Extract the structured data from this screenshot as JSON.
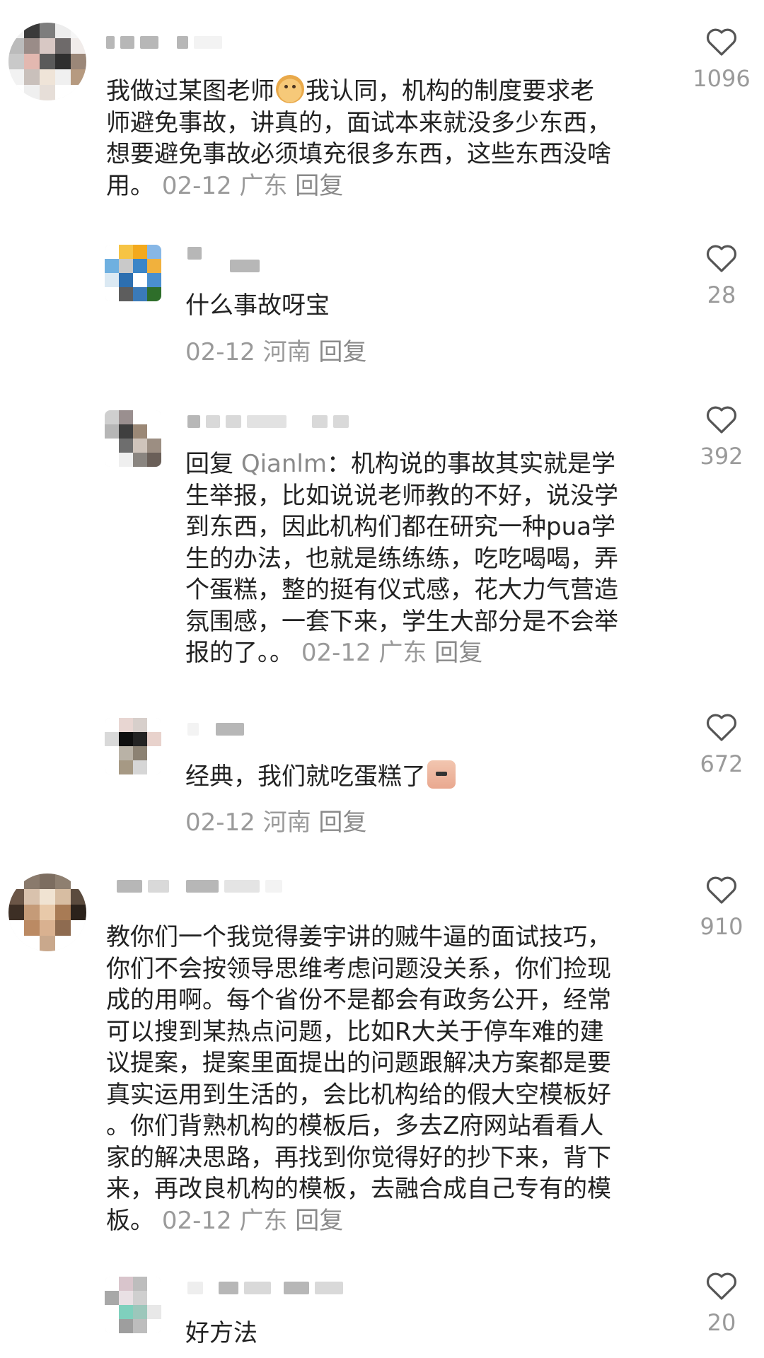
{
  "comments": [
    {
      "lines": [
        "我做过某图老师",
        "我认同，机构的制度要求老",
        "师避免事故，讲真的，面试本来就没多少东西，",
        "想要避免事故必须填充很多东西，这些东西没啥",
        "用。"
      ],
      "date": "02-12",
      "region": "广东",
      "reply_label": "回复",
      "likes": "1096"
    },
    {
      "lines": [
        "什么事故呀宝"
      ],
      "date": "02-12",
      "region": "河南",
      "reply_label": "回复",
      "likes": "28"
    },
    {
      "reply_prefix": "回复",
      "reply_to": "Qianlm",
      "lines": [
        "：机构说的事故其实就是学",
        "生举报，比如说说老师教的不好，说没学",
        "到东西，因此机构们都在研究一种pua学",
        "生的办法，也就是练练练，吃吃喝喝，弄",
        "个蛋糕，整的挺有仪式感，花大力气营造",
        "氛围感，一套下来，学生大部分是不会举",
        "报的了。。"
      ],
      "date": "02-12",
      "region": "广东",
      "reply_label": "回复",
      "likes": "392"
    },
    {
      "lines": [
        "经典，我们就吃蛋糕了"
      ],
      "date": "02-12",
      "region": "河南",
      "reply_label": "回复",
      "likes": "672"
    },
    {
      "lines": [
        "教你们一个我觉得姜宇讲的贼牛逼的面试技巧，",
        "你们不会按领导思维考虑问题没关系，你们捡现",
        "成的用啊。每个省份不是都会有政务公开，经常",
        "可以搜到某热点问题，比如R大关于停车难的建",
        "议提案，提案里面提出的问题跟解决方案都是要",
        "真实运用到生活的，会比机构给的假大空模板好",
        "。你们背熟机构的模板后，多去Z府网站看看人",
        "家的解决思路，再找到你觉得好的抄下来，背下",
        "来，再改良机构的模板，去融合成自己专有的模",
        "板。"
      ],
      "date": "02-12",
      "region": "广东",
      "reply_label": "回复",
      "likes": "910"
    },
    {
      "lines": [
        "好方法"
      ],
      "likes": "20"
    }
  ],
  "icons": {
    "like": "heart-outline-icon",
    "emoji_1": "monkey-face-emoji-icon",
    "emoji_2": "glasses-face-emoji-icon"
  },
  "colors": {
    "text": "#222222",
    "meta": "#9a9a9a",
    "icon": "#555555"
  }
}
